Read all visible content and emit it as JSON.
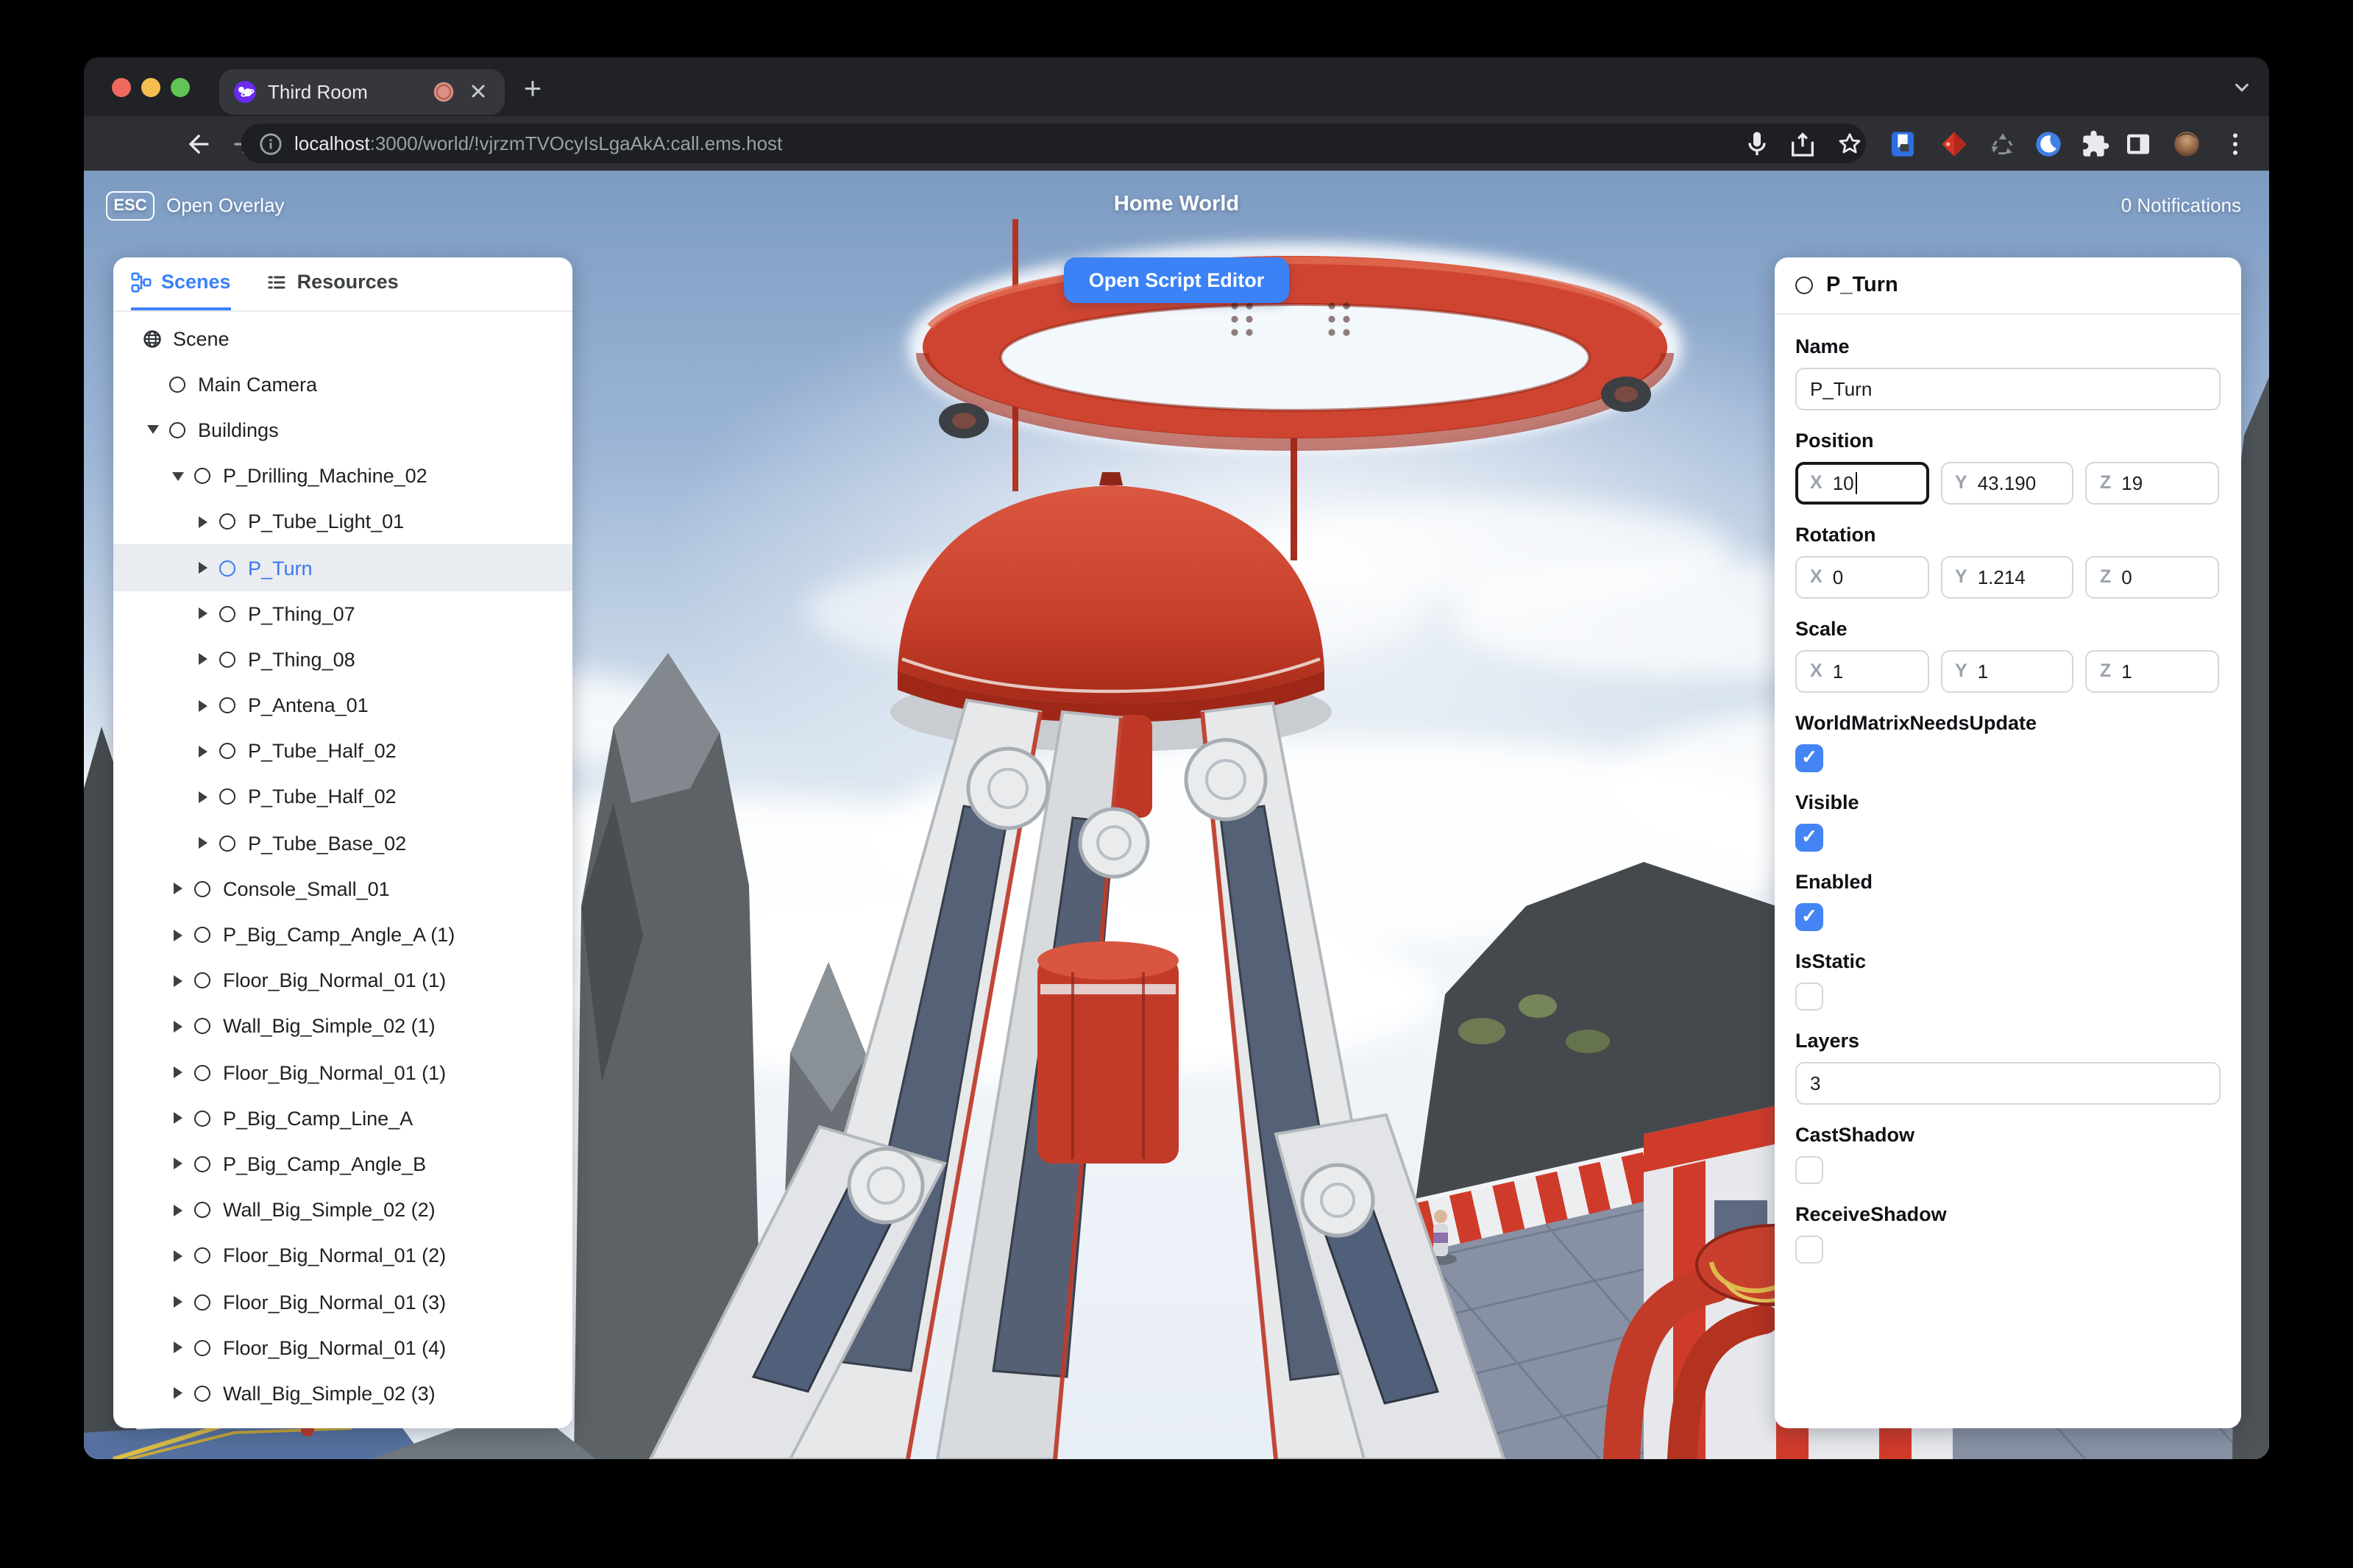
{
  "colors": {
    "accent_blue": "#3b82f6",
    "checkbox_blue": "#4484f4",
    "selected_text_blue": "#3b78f0",
    "record_red": "#dd8d82",
    "traffic_red": "#ee6a5f",
    "traffic_yellow": "#f5bd4f",
    "traffic_green": "#61c454",
    "machine_red": "#cf4430"
  },
  "browser": {
    "tab_title": "Third Room",
    "tab_icons": [
      "third-room-favicon",
      "recording-indicator-icon",
      "close-icon",
      "new-tab-plus-icon",
      "tab-search-chevron-icon"
    ],
    "url_host": "localhost",
    "url_rest": ":3000/world/!vjrzmTVOcyIsLgaAkA:call.ems.host",
    "toolbar_icons": [
      "back-icon",
      "forward-icon",
      "reload-icon",
      "info-icon",
      "microphone-icon",
      "share-icon",
      "bookmark-star-icon",
      "password-manager-extension-icon",
      "red-diamond-extension-icon",
      "recycle-extension-icon",
      "dark-mode-extension-icon",
      "extensions-puzzle-icon",
      "side-panel-icon",
      "profile-avatar",
      "menu-kebab-icon"
    ]
  },
  "hud": {
    "esc_key": "ESC",
    "open_overlay": "Open Overlay",
    "world_title": "Home World",
    "notifications": "0 Notifications",
    "open_script_editor": "Open Script Editor"
  },
  "left_panel": {
    "tabs": [
      {
        "label": "Scenes",
        "icon": "hierarchy-icon",
        "active": true
      },
      {
        "label": "Resources",
        "icon": "list-icon",
        "active": false
      }
    ],
    "tree": [
      {
        "label": "Scene",
        "level": 0,
        "icon": "globe",
        "arrow": "none",
        "selected": false
      },
      {
        "label": "Main Camera",
        "level": 1,
        "icon": "node",
        "arrow": "none",
        "selected": false
      },
      {
        "label": "Buildings",
        "level": 1,
        "icon": "node",
        "arrow": "down",
        "selected": false
      },
      {
        "label": "P_Drilling_Machine_02",
        "level": 2,
        "icon": "node",
        "arrow": "down",
        "selected": false
      },
      {
        "label": "P_Tube_Light_01",
        "level": 3,
        "icon": "node",
        "arrow": "right",
        "selected": false
      },
      {
        "label": "P_Turn",
        "level": 3,
        "icon": "node",
        "arrow": "right",
        "selected": true
      },
      {
        "label": "P_Thing_07",
        "level": 3,
        "icon": "node",
        "arrow": "right",
        "selected": false
      },
      {
        "label": "P_Thing_08",
        "level": 3,
        "icon": "node",
        "arrow": "right",
        "selected": false
      },
      {
        "label": "P_Antena_01",
        "level": 3,
        "icon": "node",
        "arrow": "right",
        "selected": false
      },
      {
        "label": "P_Tube_Half_02",
        "level": 3,
        "icon": "node",
        "arrow": "right",
        "selected": false
      },
      {
        "label": "P_Tube_Half_02",
        "level": 3,
        "icon": "node",
        "arrow": "right",
        "selected": false
      },
      {
        "label": "P_Tube_Base_02",
        "level": 3,
        "icon": "node",
        "arrow": "right",
        "selected": false
      },
      {
        "label": "Console_Small_01",
        "level": 2,
        "icon": "node",
        "arrow": "right",
        "selected": false
      },
      {
        "label": "P_Big_Camp_Angle_A (1)",
        "level": 2,
        "icon": "node",
        "arrow": "right",
        "selected": false
      },
      {
        "label": "Floor_Big_Normal_01 (1)",
        "level": 2,
        "icon": "node",
        "arrow": "right",
        "selected": false
      },
      {
        "label": "Wall_Big_Simple_02 (1)",
        "level": 2,
        "icon": "node",
        "arrow": "right",
        "selected": false
      },
      {
        "label": "Floor_Big_Normal_01 (1)",
        "level": 2,
        "icon": "node",
        "arrow": "right",
        "selected": false
      },
      {
        "label": "P_Big_Camp_Line_A",
        "level": 2,
        "icon": "node",
        "arrow": "right",
        "selected": false
      },
      {
        "label": "P_Big_Camp_Angle_B",
        "level": 2,
        "icon": "node",
        "arrow": "right",
        "selected": false
      },
      {
        "label": "Wall_Big_Simple_02 (2)",
        "level": 2,
        "icon": "node",
        "arrow": "right",
        "selected": false
      },
      {
        "label": "Floor_Big_Normal_01 (2)",
        "level": 2,
        "icon": "node",
        "arrow": "right",
        "selected": false
      },
      {
        "label": "Floor_Big_Normal_01 (3)",
        "level": 2,
        "icon": "node",
        "arrow": "right",
        "selected": false
      },
      {
        "label": "Floor_Big_Normal_01 (4)",
        "level": 2,
        "icon": "node",
        "arrow": "right",
        "selected": false
      },
      {
        "label": "Wall_Big_Simple_02 (3)",
        "level": 2,
        "icon": "node",
        "arrow": "right",
        "selected": false
      }
    ]
  },
  "inspector": {
    "title": "P_Turn",
    "sections": [
      {
        "type": "text",
        "key": "name",
        "label": "Name",
        "value": "P_Turn"
      },
      {
        "type": "vector",
        "key": "position",
        "label": "Position",
        "axes": [
          {
            "axis": "X",
            "value": "10",
            "focused": true
          },
          {
            "axis": "Y",
            "value": "43.190",
            "focused": false
          },
          {
            "axis": "Z",
            "value": "19",
            "focused": false
          }
        ]
      },
      {
        "type": "vector",
        "key": "rotation",
        "label": "Rotation",
        "axes": [
          {
            "axis": "X",
            "value": "0",
            "focused": false
          },
          {
            "axis": "Y",
            "value": "1.214",
            "focused": false
          },
          {
            "axis": "Z",
            "value": "0",
            "focused": false
          }
        ]
      },
      {
        "type": "vector",
        "key": "scale",
        "label": "Scale",
        "axes": [
          {
            "axis": "X",
            "value": "1",
            "focused": false
          },
          {
            "axis": "Y",
            "value": "1",
            "focused": false
          },
          {
            "axis": "Z",
            "value": "1",
            "focused": false
          }
        ]
      },
      {
        "type": "checkbox",
        "key": "worldMatrixNeedsUpdate",
        "label": "WorldMatrixNeedsUpdate",
        "checked": true
      },
      {
        "type": "checkbox",
        "key": "visible",
        "label": "Visible",
        "checked": true
      },
      {
        "type": "checkbox",
        "key": "enabled",
        "label": "Enabled",
        "checked": true
      },
      {
        "type": "checkbox",
        "key": "isStatic",
        "label": "IsStatic",
        "checked": false
      },
      {
        "type": "text",
        "key": "layers",
        "label": "Layers",
        "value": "3"
      },
      {
        "type": "checkbox",
        "key": "castShadow",
        "label": "CastShadow",
        "checked": false
      },
      {
        "type": "checkbox",
        "key": "receiveShadow",
        "label": "ReceiveShadow",
        "checked": false
      }
    ]
  }
}
